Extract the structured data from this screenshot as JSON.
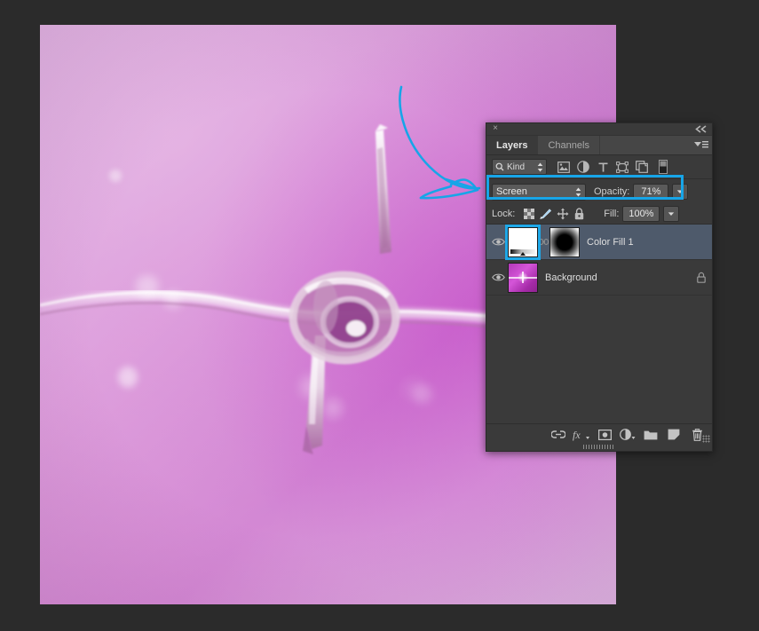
{
  "app": {
    "background_color": "#2b2b2b"
  },
  "photo": {
    "name": "barbed-wire-macro-photo",
    "description": "Soft pink and magenta blurred macro photograph of a barbed wire knot with bokeh highlights"
  },
  "annotation": {
    "arrow_color": "#17a5e8",
    "highlight_color": "#17a5e8",
    "arrow_name": "hand-drawn-arrow-pointing-to-blend-mode-row"
  },
  "panel": {
    "close_label": "×",
    "collapse_label": "collapse-panel",
    "menu_label": "panel-menu",
    "tabs": [
      {
        "label": "Layers",
        "active": true
      },
      {
        "label": "Channels",
        "active": false
      }
    ],
    "filter": {
      "kind_label": "Kind",
      "search_icon": "search-icon",
      "stepper_icon": "stepper-icon",
      "icons": [
        {
          "name": "filter-pixel-layers-icon",
          "glyph": "image"
        },
        {
          "name": "filter-adjustment-layers-icon",
          "glyph": "circle-half"
        },
        {
          "name": "filter-type-layers-icon",
          "glyph": "T"
        },
        {
          "name": "filter-shape-layers-icon",
          "glyph": "shape"
        },
        {
          "name": "filter-smart-objects-icon",
          "glyph": "smart"
        },
        {
          "name": "filter-toggle-icon",
          "glyph": "switch"
        }
      ]
    },
    "blend": {
      "mode": "Screen",
      "opacity_label": "Opacity:",
      "opacity_value": "71%"
    },
    "lock": {
      "label": "Lock:",
      "icons": [
        {
          "name": "lock-transparent-pixels-icon"
        },
        {
          "name": "lock-image-pixels-icon"
        },
        {
          "name": "lock-position-icon"
        },
        {
          "name": "lock-all-icon"
        }
      ],
      "fill_label": "Fill:",
      "fill_value": "100%"
    },
    "layers": [
      {
        "name": "Color Fill 1",
        "selected": true,
        "visible": true,
        "locked": false,
        "thumb": "gradient-fill",
        "has_mask": true,
        "linked": true
      },
      {
        "name": "Background",
        "selected": false,
        "visible": true,
        "locked": true,
        "thumb": "photo",
        "has_mask": false,
        "linked": false
      }
    ],
    "bottom_icons": [
      {
        "name": "link-layers-icon",
        "label": "link"
      },
      {
        "name": "layer-style-fx-icon",
        "label": "fx"
      },
      {
        "name": "add-layer-mask-icon",
        "label": "mask"
      },
      {
        "name": "new-adjustment-layer-icon",
        "label": "adjustment"
      },
      {
        "name": "new-group-icon",
        "label": "group"
      },
      {
        "name": "new-layer-icon",
        "label": "new-layer"
      },
      {
        "name": "delete-layer-icon",
        "label": "delete"
      }
    ]
  }
}
